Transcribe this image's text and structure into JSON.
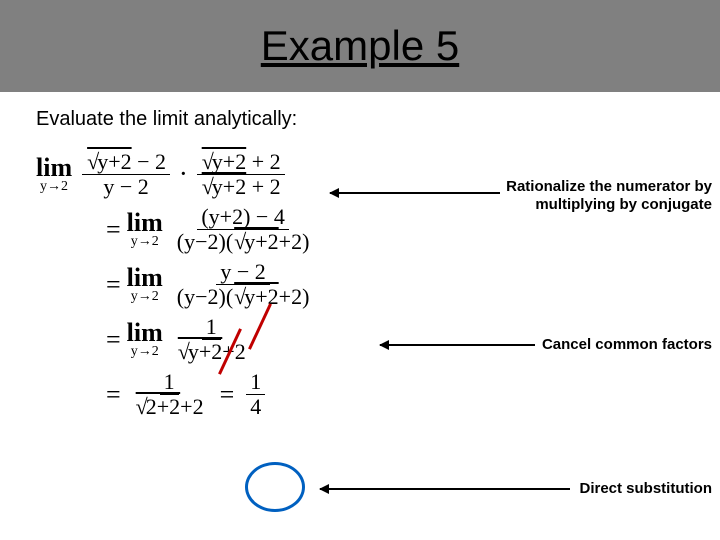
{
  "title": "Example 5",
  "instruction": "Evaluate the limit analytically:",
  "math": {
    "lim_word": "lim",
    "lim_sub": "y→2",
    "line1_fracA_num": "√(y+2) − 2",
    "line1_fracA_den": "y − 2",
    "line1_dot": "·",
    "line1_fracB_num": "√(y+2) + 2",
    "line1_fracB_den": "√(y+2) + 2",
    "line2_num": "(y+2) − 4",
    "line2_den": "(y−2)(√(y+2)+2)",
    "line3_num": "y − 2",
    "line3_den": "(y−2)(√(y+2)+2)",
    "line4_num": "1",
    "line4_den": "√(y+2)+2",
    "line5_left_num": "1",
    "line5_left_den": "√(2+2)+2",
    "line5_eq": "=",
    "line5_right_num": "1",
    "line5_right_den": "4",
    "equals": "="
  },
  "annotations": {
    "a1_line1": "Rationalize the numerator by",
    "a1_line2": "multiplying by conjugate",
    "a2": "Cancel common factors",
    "a3": "Direct substitution"
  }
}
